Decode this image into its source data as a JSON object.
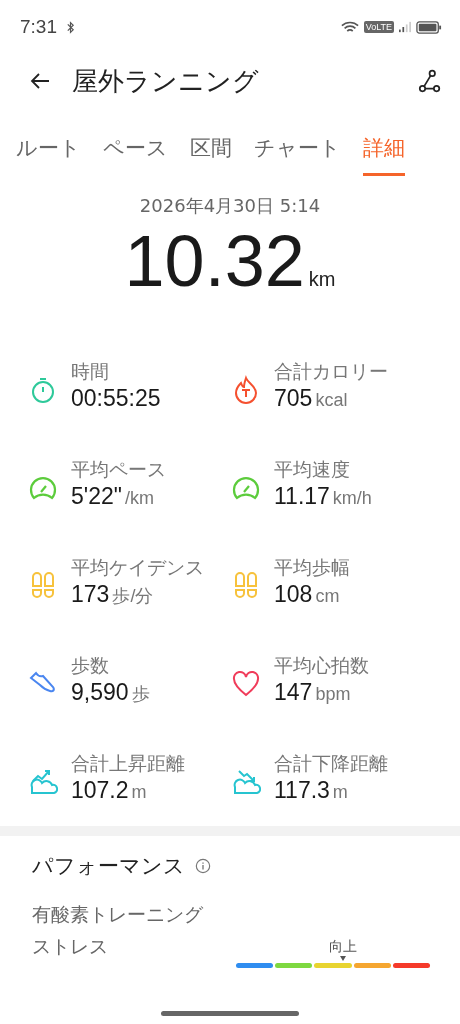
{
  "status_bar": {
    "time": "7:31",
    "network": "VoLTE"
  },
  "header": {
    "title": "屋外ランニング"
  },
  "tabs": [
    {
      "label": "ルート",
      "selected": false
    },
    {
      "label": "ペース",
      "selected": false
    },
    {
      "label": "区間",
      "selected": false
    },
    {
      "label": "チャート",
      "selected": false
    },
    {
      "label": "詳細",
      "selected": true
    }
  ],
  "summary": {
    "date": "2026年4月30日 5:14",
    "distance": "10.32",
    "unit": "km"
  },
  "metrics": [
    {
      "label": "時間",
      "value": "00:55:25",
      "kind": "timer",
      "color": "#2ec99a"
    },
    {
      "label": "合計カロリー",
      "value": "705",
      "unit": "kcal",
      "kind": "flame",
      "color": "#f5502f"
    },
    {
      "label": "平均ペース",
      "value": "5'22\"",
      "unit": "/km",
      "kind": "gauge",
      "color": "#5ccc3c"
    },
    {
      "label": "平均速度",
      "value": "11.17",
      "unit": "km/h",
      "kind": "gauge",
      "color": "#5ccc3c"
    },
    {
      "label": "平均ケイデンス",
      "value": "173",
      "unit": "歩/分",
      "kind": "feet",
      "color": "#f7c23c"
    },
    {
      "label": "平均歩幅",
      "value": "108",
      "unit": "cm",
      "kind": "feet",
      "color": "#f7c23c"
    },
    {
      "label": "歩数",
      "value": "9,590",
      "unit": "歩",
      "kind": "shoe",
      "color": "#4a86f0"
    },
    {
      "label": "平均心拍数",
      "value": "147",
      "unit": "bpm",
      "kind": "heart",
      "color": "#f03c5a"
    },
    {
      "label": "合計上昇距離",
      "value": "107.2",
      "unit": "m",
      "kind": "ascent",
      "color": "#26c4d0"
    },
    {
      "label": "合計下降距離",
      "value": "117.3",
      "unit": "m",
      "kind": "descent",
      "color": "#26c4d0"
    }
  ],
  "performance": {
    "title": "パフォーマンス",
    "metric_label": "有酸素トレーニングストレス",
    "scale": {
      "marker_label": "向上",
      "segments": [
        {
          "color": "#2f8df0"
        },
        {
          "color": "#7ed840"
        },
        {
          "color": "#e8d430"
        },
        {
          "color": "#f5a630"
        },
        {
          "color": "#f53a2a"
        }
      ]
    }
  }
}
